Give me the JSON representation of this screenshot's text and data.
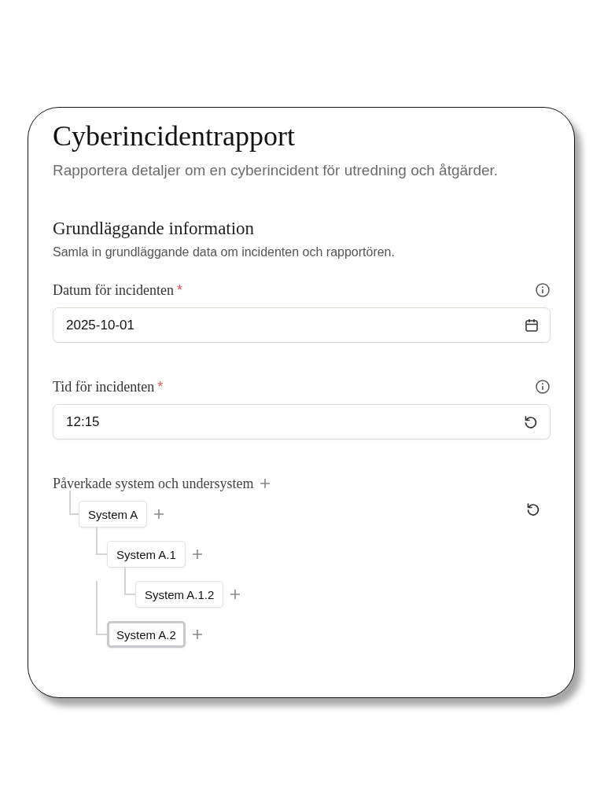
{
  "form": {
    "title": "Cyberincidentrapport",
    "description": "Rapportera detaljer om en cyberincident för utredning och åtgärder."
  },
  "section": {
    "title": "Grundläggande information",
    "description": "Samla in grundläggande data om incidenten och rapportören."
  },
  "fields": [
    {
      "label": "Datum för incidenten",
      "required_mark": "*",
      "kind": "date",
      "value": "2025-10-01"
    },
    {
      "label": "Tid för incidenten",
      "required_mark": "*",
      "kind": "time",
      "value": "12:15"
    }
  ],
  "tree": {
    "label": "Påverkade system och undersystem",
    "nodes": [
      {
        "label": "System A",
        "selected": false,
        "children": [
          {
            "label": "System A.1",
            "selected": false,
            "children": [
              {
                "label": "System A.1.2",
                "selected": false
              }
            ]
          },
          {
            "label": "System A.2",
            "selected": true
          }
        ]
      }
    ]
  }
}
